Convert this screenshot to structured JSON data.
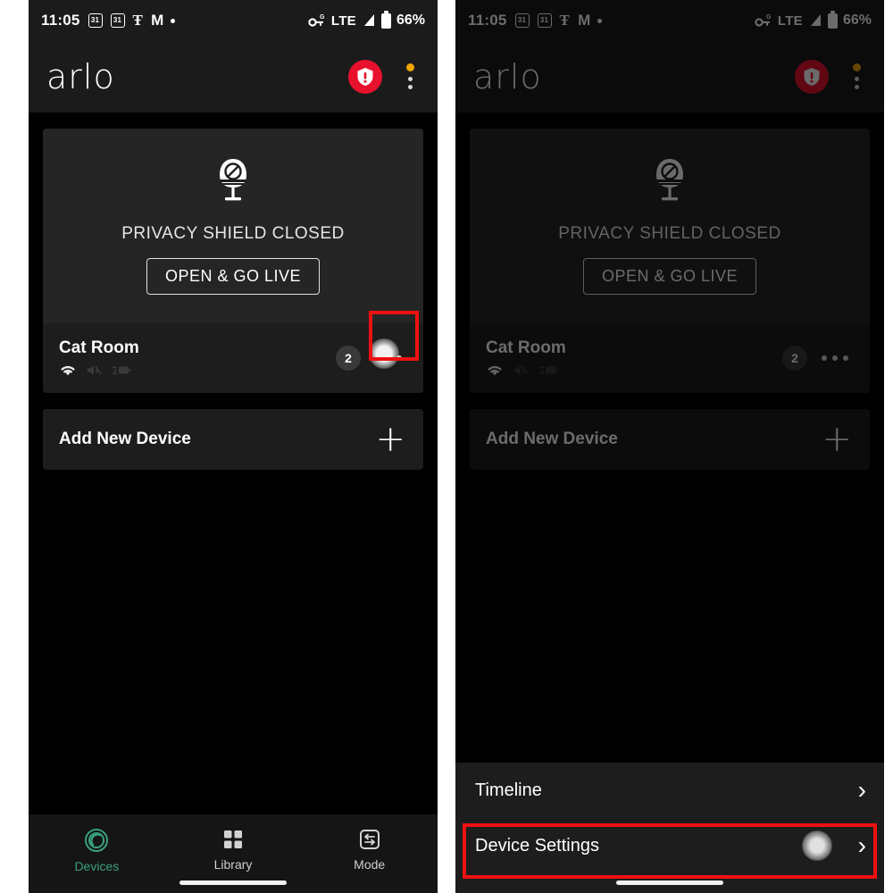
{
  "status_bar": {
    "time": "11:05",
    "icons": [
      "calendar-31-icon",
      "calendar-31-icon",
      "nyt-icon",
      "gmail-icon",
      "dot-icon"
    ],
    "calendar_day": "31",
    "nyt_glyph": "Ŧ",
    "gmail_glyph": "M",
    "network": "LTE",
    "battery_percent": "66%"
  },
  "app_header": {
    "logo": "arlo",
    "alert_icon": "shield-alert-icon",
    "alert_glyph": "!",
    "menu_icon": "overflow-menu-icon",
    "alert_color": "#e8112d",
    "notification_dot_color": "#f0a500"
  },
  "device_card": {
    "status_icon": "privacy-shield-closed-icon",
    "status_text": "PRIVACY SHIELD CLOSED",
    "live_button": "OPEN & GO LIVE",
    "name": "Cat Room",
    "signal_icon": "wifi-icon",
    "audio_icon": "speaker-muted-icon",
    "battery_icon": "battery-icon",
    "badge_count": "2",
    "menu_icon": "three-dot-menu-icon"
  },
  "add_device": {
    "label": "Add New Device",
    "icon": "plus-icon"
  },
  "bottom_nav": {
    "items": [
      {
        "label": "Devices",
        "icon": "camera-lens-icon",
        "active": true
      },
      {
        "label": "Library",
        "icon": "grid-icon",
        "active": false
      },
      {
        "label": "Mode",
        "icon": "mode-arrows-icon",
        "active": false
      }
    ],
    "active_color": "#37a07e"
  },
  "bottom_sheet": {
    "rows": [
      {
        "label": "Timeline",
        "icon": "chevron-right-icon",
        "highlighted": false
      },
      {
        "label": "Device Settings",
        "icon": "chevron-right-icon",
        "highlighted": true
      }
    ]
  },
  "annotations": {
    "highlight_color": "#ee1111",
    "left_target": "three-dot-menu-icon",
    "right_target": "device-settings-row"
  }
}
